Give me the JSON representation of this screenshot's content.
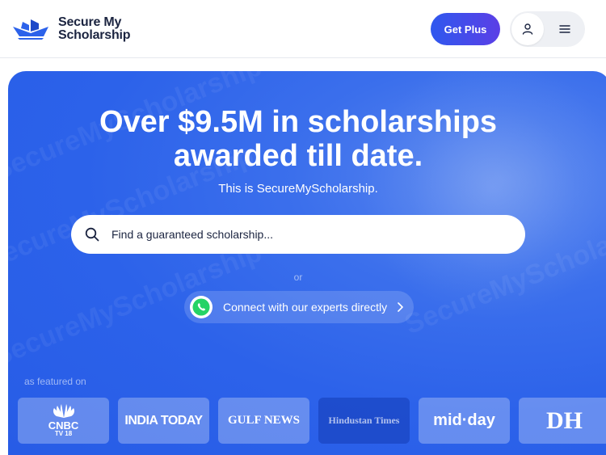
{
  "header": {
    "logo_line1": "Secure My",
    "logo_line2": "Scholarship",
    "get_plus_label": "Get Plus"
  },
  "hero": {
    "headline_line1": "Over $9.5M in scholarships",
    "headline_line2": "awarded till date.",
    "subline": "This is SecureMyScholarship.",
    "search_placeholder": "Find a guaranteed scholarship...",
    "or_label": "or",
    "whatsapp_label": "Connect with our experts directly",
    "featured_label": "as featured on"
  },
  "press_logos": [
    {
      "name": "CNBC TV18",
      "line1": "CNBC",
      "line2": "TV 18"
    },
    {
      "name": "India Today",
      "text": "INDIA TODAY"
    },
    {
      "name": "Gulf News",
      "text": "GULF NEWS"
    },
    {
      "name": "Hindustan Times",
      "text": "Hindustan Times"
    },
    {
      "name": "Mid-day",
      "text": "mid·day"
    },
    {
      "name": "Deccan Herald",
      "text": "DH"
    }
  ],
  "colors": {
    "brand_blue": "#2c62ea",
    "button_gradient_start": "#2f58ee",
    "button_gradient_end": "#5b3fe6",
    "whatsapp_green": "#25d366"
  },
  "icons": [
    "logo-boat-icon",
    "user-icon",
    "menu-icon",
    "search-icon",
    "whatsapp-icon",
    "chevron-right-icon"
  ]
}
